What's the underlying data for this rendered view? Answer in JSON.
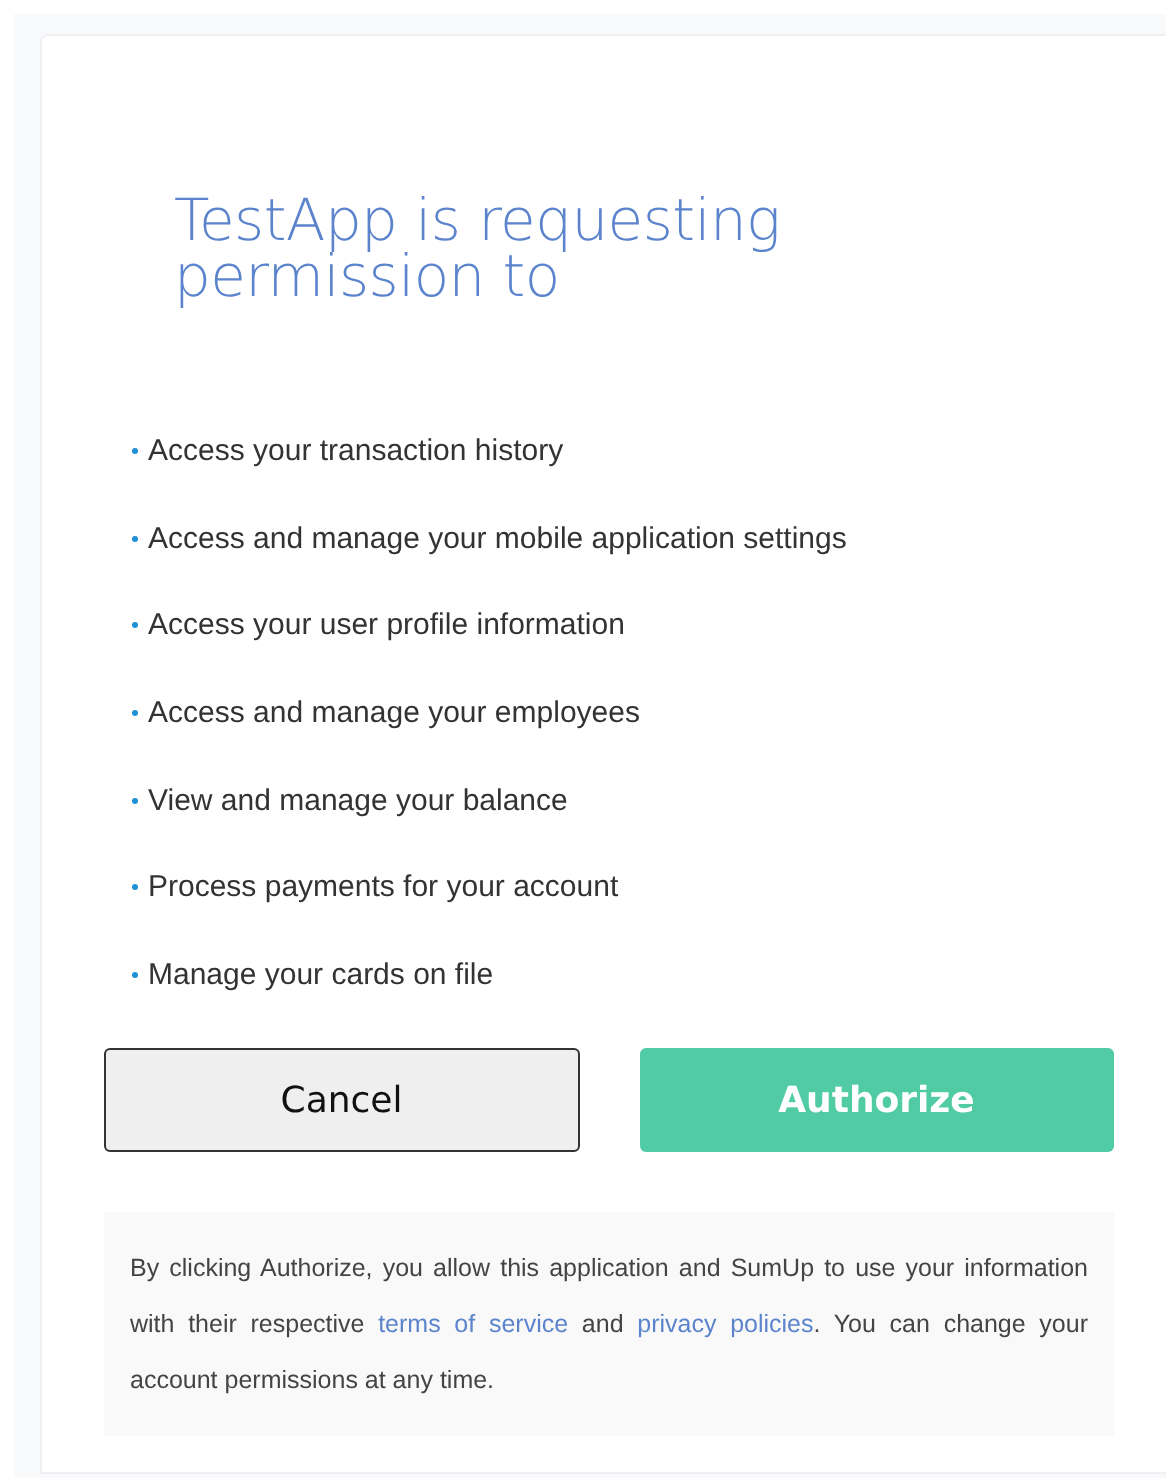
{
  "title": "TestApp is requesting permission to",
  "permissions": [
    {
      "text": "Access your transaction history"
    },
    {
      "text": "Access and manage your mobile application settings"
    },
    {
      "text": "Access your user profile information"
    },
    {
      "text": "Access and manage your employees"
    },
    {
      "text": "View and manage your balance"
    },
    {
      "text": "Process payments for your account"
    },
    {
      "text": "Manage your cards on file"
    }
  ],
  "buttons": [
    {
      "kind": "secondary",
      "label": "Cancel"
    },
    {
      "kind": "primary",
      "label": "Authorize"
    }
  ],
  "notice": [
    {
      "kind": "text",
      "text": "By clicking Authorize, you allow this application and SumUp to use your information with their respective "
    },
    {
      "kind": "link",
      "text": "terms of service"
    },
    {
      "kind": "text",
      "text": " and "
    },
    {
      "kind": "link",
      "text": "privacy policies"
    },
    {
      "kind": "text",
      "text": ". You can change your account permissions at any time."
    }
  ]
}
